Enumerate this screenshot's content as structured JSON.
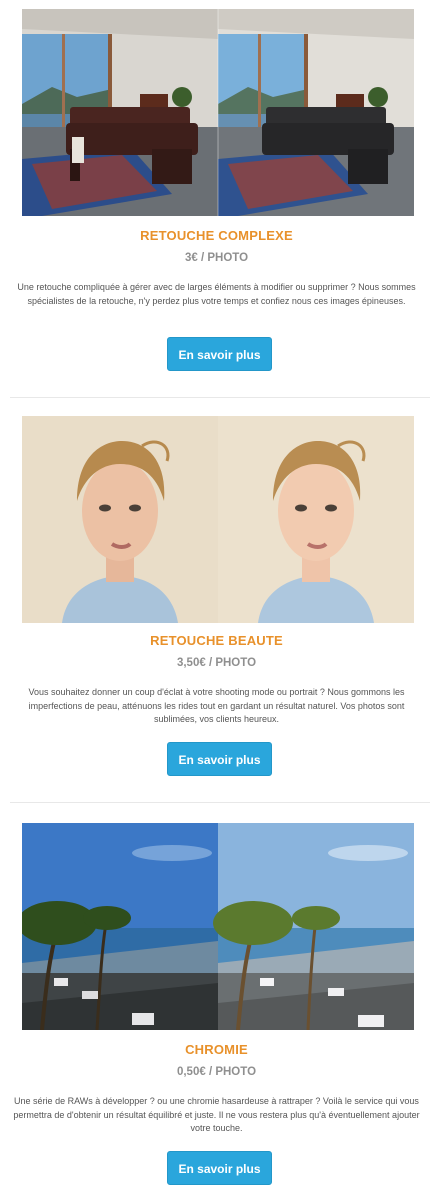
{
  "sections": [
    {
      "title": "RETOUCHE COMPLEXE",
      "price": "3€ / PHOTO",
      "description": "Une retouche compliquée à gérer avec de larges éléments à modifier ou supprimer ? Nous sommes spécialistes de la retouche, n'y perdez plus votre temps et confiez nous ces images épineuses.",
      "button_label": "En savoir plus"
    },
    {
      "title": "RETOUCHE BEAUTE",
      "price": "3,50€ / PHOTO",
      "description": "Vous souhaitez donner un coup d'éclat à votre shooting mode ou portrait ? Nous gommons les imperfections de peau, atténuons les rides tout en gardant un résultat naturel. Vos photos sont sublimées, vos clients heureux.",
      "button_label": "En savoir plus"
    },
    {
      "title": "CHROMIE",
      "price": "0,50€ / PHOTO",
      "description": "Une série de RAWs à développer ? ou une chromie hasardeuse à rattraper ? Voilà le service qui vous permettra de d'obtenir un résultat équilibré et juste. Il ne vous restera plus qu'à éventuellement ajouter votre touche.",
      "button_label": "En savoir plus"
    }
  ],
  "colors": {
    "accent": "#e8912b",
    "button": "#2aa6dc",
    "price": "#8f8f8f"
  }
}
